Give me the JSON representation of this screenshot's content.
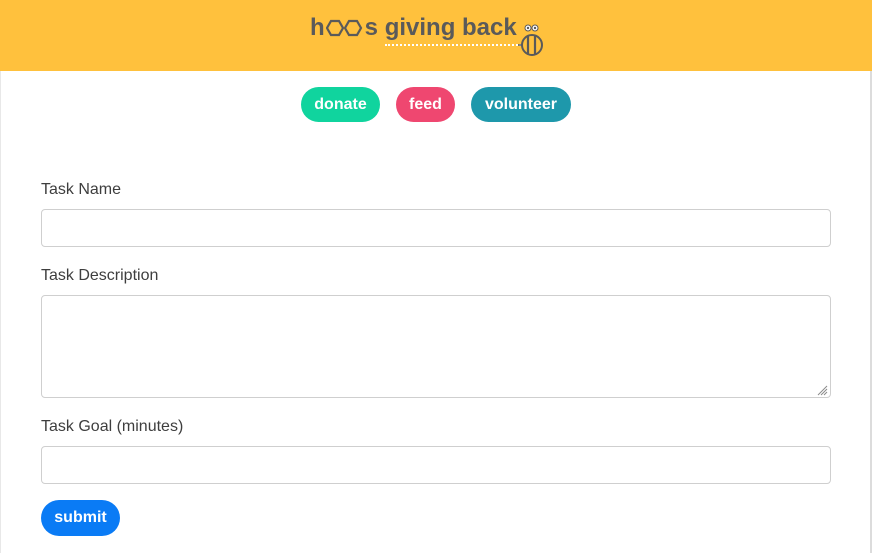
{
  "header": {
    "logo_prefix": "h",
    "logo_suffix": "s giving back",
    "logo_icons": [
      "hexagon-icon",
      "hexagon-icon",
      "bee-icon"
    ],
    "background_color": "#ffc13d",
    "text_color": "#5a5a5a"
  },
  "nav": {
    "items": [
      {
        "label": "donate",
        "color": "#10d49e"
      },
      {
        "label": "feed",
        "color": "#ef4770"
      },
      {
        "label": "volunteer",
        "color": "#1e98ab"
      }
    ]
  },
  "form": {
    "task_name": {
      "label": "Task Name",
      "value": "",
      "placeholder": ""
    },
    "task_description": {
      "label": "Task Description",
      "value": "",
      "placeholder": ""
    },
    "task_goal": {
      "label": "Task Goal (minutes)",
      "value": "",
      "placeholder": ""
    },
    "submit_label": "submit",
    "submit_color": "#0a7bf5"
  }
}
